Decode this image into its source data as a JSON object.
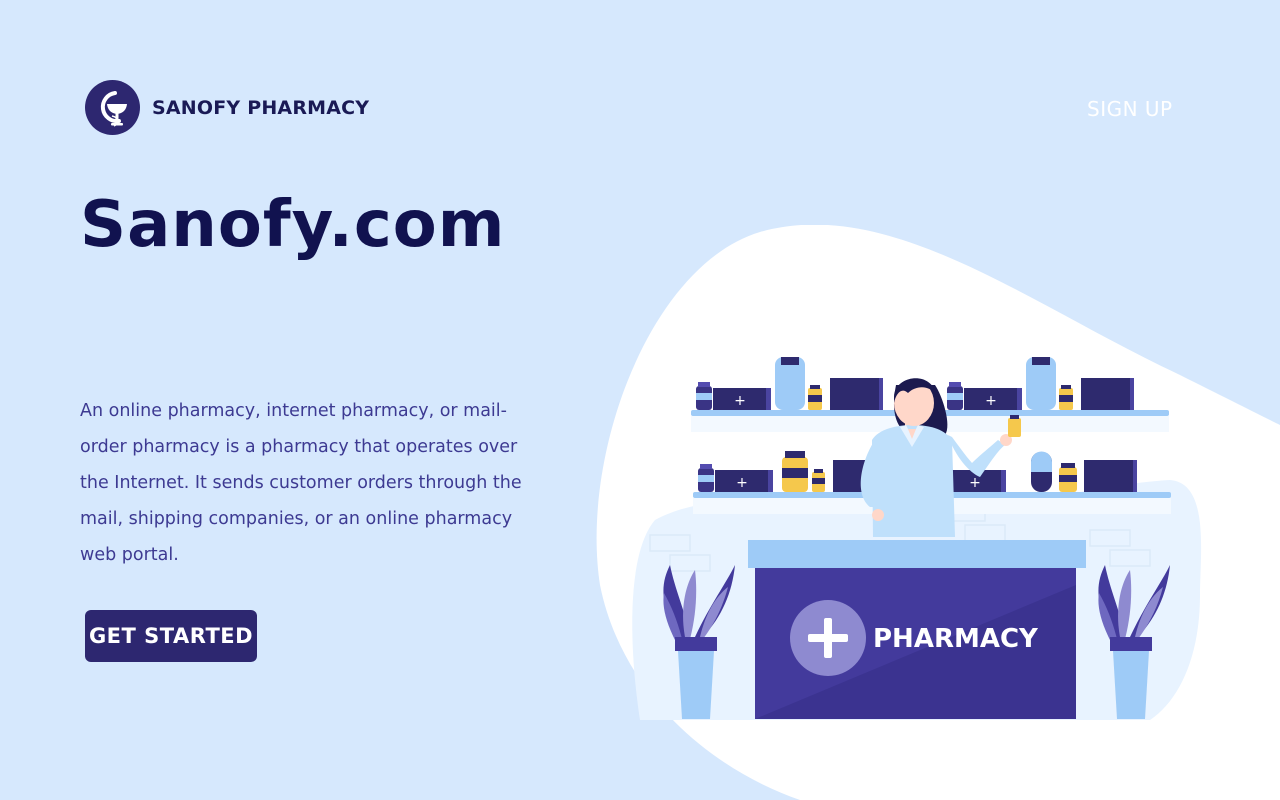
{
  "brand": {
    "name": "SANOFY PHARMACY"
  },
  "nav": {
    "signup_label": "SIGN UP"
  },
  "hero": {
    "title": "Sanofy.com",
    "description": "An online pharmacy, internet pharmacy, or mail-order pharmacy is a pharmacy that operates over the Internet. It sends customer orders through the mail, shipping companies, or an online pharmacy web portal.",
    "cta_label": "GET STARTED"
  },
  "illustration": {
    "counter_label": "PHARMACY"
  },
  "colors": {
    "background": "#d6e8fd",
    "brand_navy": "#2d2770",
    "title_navy": "#11124f",
    "text_purple": "#3d3a92",
    "counter_purple": "#433a9c",
    "shelf_blue": "#9ecbf7"
  }
}
